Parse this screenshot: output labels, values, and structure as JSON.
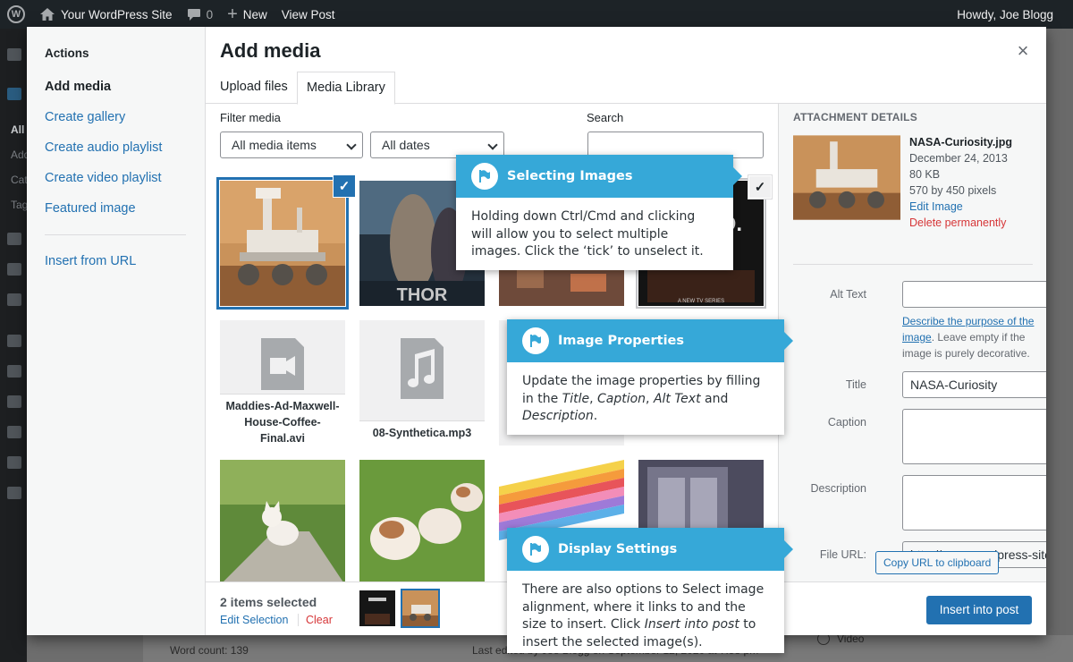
{
  "adminbar": {
    "site_name": "Your WordPress Site",
    "comments_count": "0",
    "new_label": "New",
    "view_post": "View Post",
    "greeting": "Howdy, Joe Blogg"
  },
  "background": {
    "sidebar_fragments": [
      "All",
      "Add",
      "Cat",
      "Tag"
    ],
    "word_count": "Word count: 139",
    "last_edited": "Last edited by Joe Blogg on September 12, 2020 at 7:58 pm",
    "video_option": "Video"
  },
  "modal": {
    "title": "Add media",
    "close_label": "×",
    "menu": {
      "heading": "Actions",
      "items": [
        {
          "label": "Add media"
        },
        {
          "label": "Create gallery"
        },
        {
          "label": "Create audio playlist"
        },
        {
          "label": "Create video playlist"
        },
        {
          "label": "Featured image"
        },
        {
          "label": "Insert from URL"
        }
      ]
    },
    "tabs": [
      "Upload files",
      "Media Library"
    ],
    "filter": {
      "label": "Filter media",
      "type_value": "All media items",
      "date_value": "All dates",
      "search_label": "Search",
      "search_value": ""
    },
    "grid": {
      "files": [
        {
          "name": "Maddies-Ad-Maxwell-House-Coffee-Final.avi",
          "icon": "video-file-icon"
        },
        {
          "name": "08-Synthetica.mp3",
          "icon": "audio-file-icon"
        }
      ],
      "thor_label": "THOR",
      "poster_text": "D.",
      "poster_bottom": "A NEW TV SERIES"
    },
    "details": {
      "section_title": "Attachment Details",
      "filename": "NASA-Curiosity.jpg",
      "date": "December 24, 2013",
      "size": "80 KB",
      "dimensions": "570 by 450 pixels",
      "edit_link": "Edit Image",
      "delete_link": "Delete permanently",
      "alt_label": "Alt Text",
      "alt_value": "",
      "help_link": "Describe the purpose of the image",
      "help_text": ". Leave empty if the image is purely decorative.",
      "title_label": "Title",
      "title_value": "NASA-Curiosity",
      "caption_label": "Caption",
      "caption_value": "",
      "description_label": "Description",
      "description_value": "",
      "url_label": "File URL:",
      "url_value": "http://your-wordpress-site",
      "copy_button": "Copy URL to clipboard"
    },
    "toolbar": {
      "selected_count": "2 items selected",
      "edit_selection": "Edit Selection",
      "clear": "Clear",
      "insert_button": "Insert into post"
    }
  },
  "callouts": [
    {
      "title": "Selecting Images",
      "body": "Holding down Ctrl/Cmd and clicking will allow you to select multiple images. Click the ‘tick’ to unselect it."
    },
    {
      "title": "Image Properties",
      "body_prefix": "Update the image properties by filling in the ",
      "body_i1": "Title",
      "body_sep1": ", ",
      "body_i2": "Caption",
      "body_sep2": ", ",
      "body_i3": "Alt Text",
      "body_and": " and ",
      "body_i4": "Description",
      "body_suffix": "."
    },
    {
      "title": "Display Settings",
      "body_prefix": "There are also options to Select image alignment, where it links to and the size to insert. Click ",
      "body_em": "Insert into post",
      "body_suffix": " to insert the selected image(s)."
    }
  ],
  "colors": {
    "accent": "#2271b1",
    "callout": "#36a8d8",
    "danger": "#d63638",
    "adminbar": "#1d2327"
  }
}
